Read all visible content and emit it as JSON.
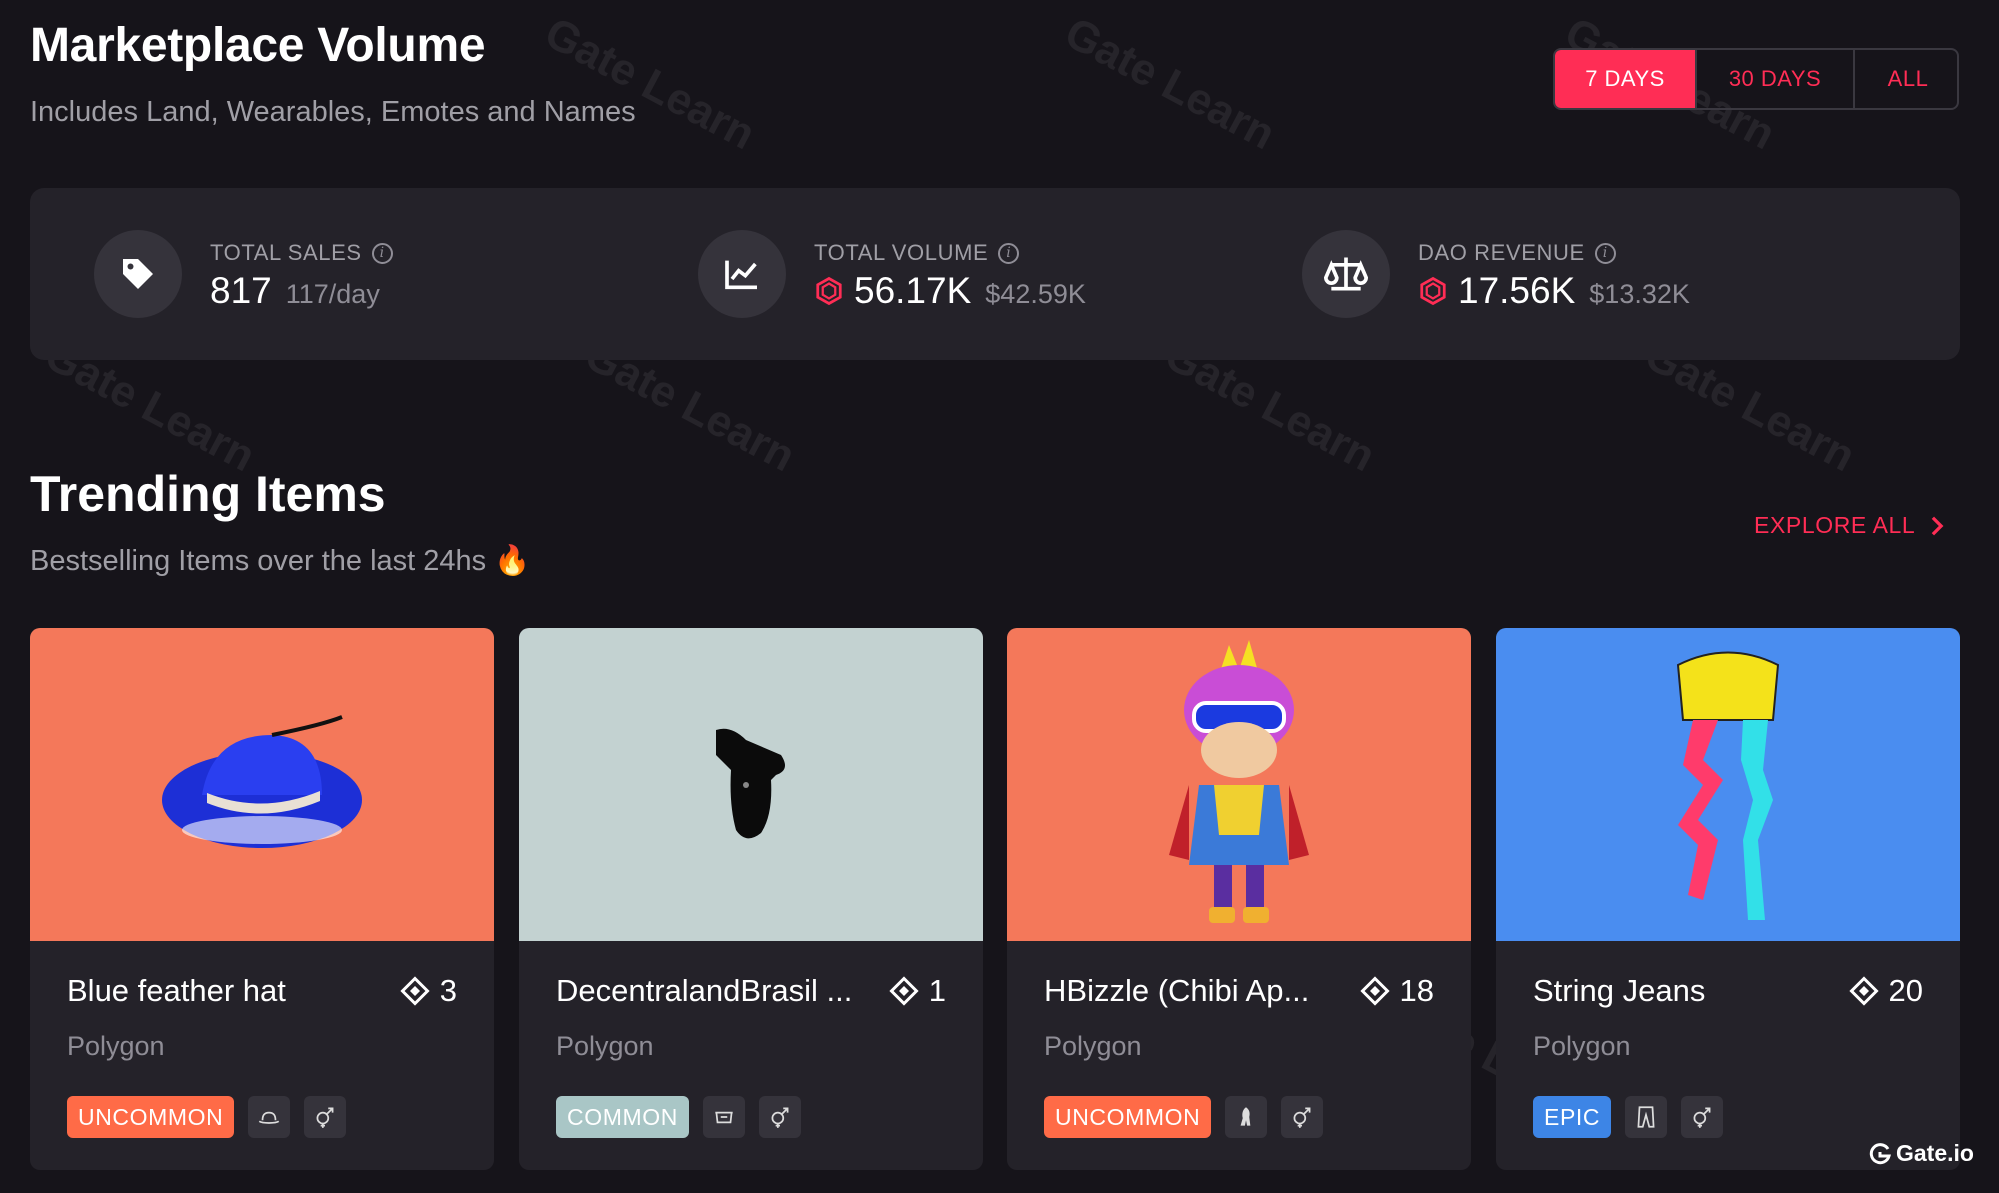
{
  "header": {
    "title": "Marketplace Volume",
    "subtitle": "Includes Land, Wearables, Emotes and Names",
    "range_options": [
      "7 DAYS",
      "30 DAYS",
      "ALL"
    ],
    "range_selected": "7 DAYS"
  },
  "stats": [
    {
      "label": "TOTAL SALES",
      "value": "817",
      "secondary": "117/day",
      "icon": "tag-icon"
    },
    {
      "label": "TOTAL VOLUME",
      "value": "56.17K",
      "secondary": "$42.59K",
      "icon": "chart-icon"
    },
    {
      "label": "DAO REVENUE",
      "value": "17.56K",
      "secondary": "$13.32K",
      "icon": "scale-icon"
    }
  ],
  "trending": {
    "title": "Trending Items",
    "subtitle": "Bestselling Items over the last 24hs 🔥",
    "explore_label": "EXPLORE ALL"
  },
  "items": [
    {
      "name": "Blue feather hat",
      "price": "3",
      "network": "Polygon",
      "rarity": "UNCOMMON",
      "rarity_color": "#ff6b47",
      "bg": "#f4785a",
      "category_icon": "hat-icon"
    },
    {
      "name": "DecentralandBrasil ...",
      "price": "1",
      "network": "Polygon",
      "rarity": "COMMON",
      "rarity_color": "#a9c6c6",
      "bg": "#c3d2d1",
      "category_icon": "upper-body-icon"
    },
    {
      "name": "HBizzle (Chibi Ap...",
      "price": "18",
      "network": "Polygon",
      "rarity": "UNCOMMON",
      "rarity_color": "#ff6b47",
      "bg": "#f4785a",
      "category_icon": "skin-icon"
    },
    {
      "name": "String Jeans",
      "price": "20",
      "network": "Polygon",
      "rarity": "EPIC",
      "rarity_color": "#3d85e6",
      "bg": "#4a8df0",
      "category_icon": "lower-body-icon"
    }
  ],
  "watermark": "Gate Learn",
  "brand": "Gate.io",
  "colors": {
    "accent": "#ff2d55",
    "background": "#16141a",
    "panel": "#242229"
  }
}
